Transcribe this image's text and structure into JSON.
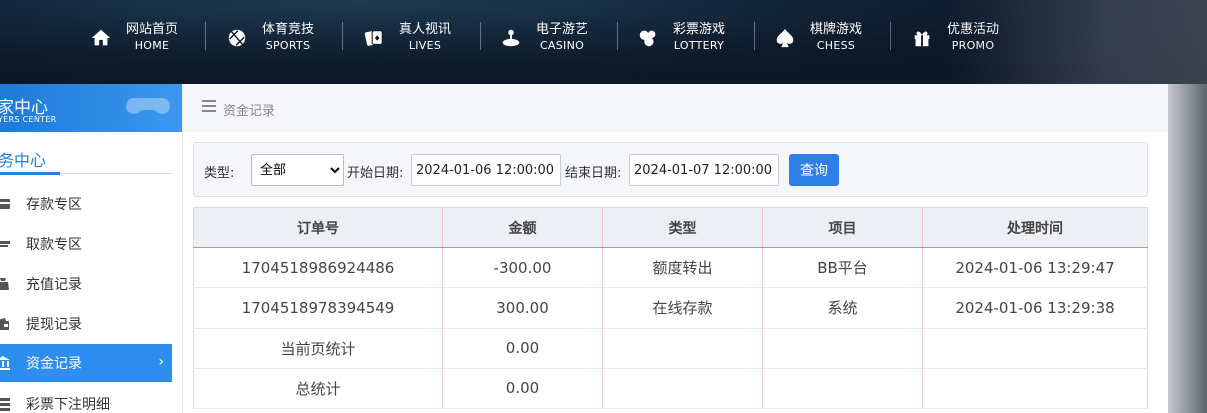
{
  "nav": {
    "items": [
      {
        "cn": "网站首页",
        "en": "HOME",
        "icon": "home-icon"
      },
      {
        "cn": "体育竞技",
        "en": "SPORTS",
        "icon": "ball-icon"
      },
      {
        "cn": "真人视讯",
        "en": "LIVES",
        "icon": "cards-icon"
      },
      {
        "cn": "电子游艺",
        "en": "CASINO",
        "icon": "joystick-icon"
      },
      {
        "cn": "彩票游戏",
        "en": "LOTTERY",
        "icon": "lottery-balls-icon"
      },
      {
        "cn": "棋牌游戏",
        "en": "CHESS",
        "icon": "spade-icon"
      },
      {
        "cn": "优惠活动",
        "en": "PROMO",
        "icon": "gift-icon"
      }
    ]
  },
  "sidebar": {
    "title": "家中心",
    "subtitle": "YERS CENTER",
    "section": "务中心",
    "items": [
      {
        "label": "存款专区",
        "icon": "card-icon"
      },
      {
        "label": "取款专区",
        "icon": "cash-icon"
      },
      {
        "label": "充值记录",
        "icon": "bag-icon"
      },
      {
        "label": "提现记录",
        "icon": "wallet-icon"
      },
      {
        "label": "资金记录",
        "icon": "bank-icon",
        "active": true
      },
      {
        "label": "彩票下注明细",
        "icon": "list-icon"
      }
    ]
  },
  "breadcrumb": "资金记录",
  "filter": {
    "type_label": "类型:",
    "type_value": "全部",
    "start_label": "开始日期:",
    "start_value": "2024-01-06 12:00:00",
    "end_label": "结束日期:",
    "end_value": "2024-01-07 12:00:00",
    "query_label": "查询"
  },
  "table": {
    "headers": [
      "订单号",
      "金额",
      "类型",
      "项目",
      "处理时间"
    ],
    "rows": [
      [
        "1704518986924486",
        "-300.00",
        "额度转出",
        "BB平台",
        "2024-01-06 13:29:47"
      ],
      [
        "1704518978394549",
        "300.00",
        "在线存款",
        "系统",
        "2024-01-06 13:29:38"
      ],
      [
        "当前页统计",
        "0.00",
        "",
        "",
        ""
      ],
      [
        "总统计",
        "0.00",
        "",
        "",
        ""
      ]
    ]
  },
  "colors": {
    "accent": "#2e8ef0",
    "button": "#2e7fe6",
    "nav_bg": "#0d1a2a"
  }
}
